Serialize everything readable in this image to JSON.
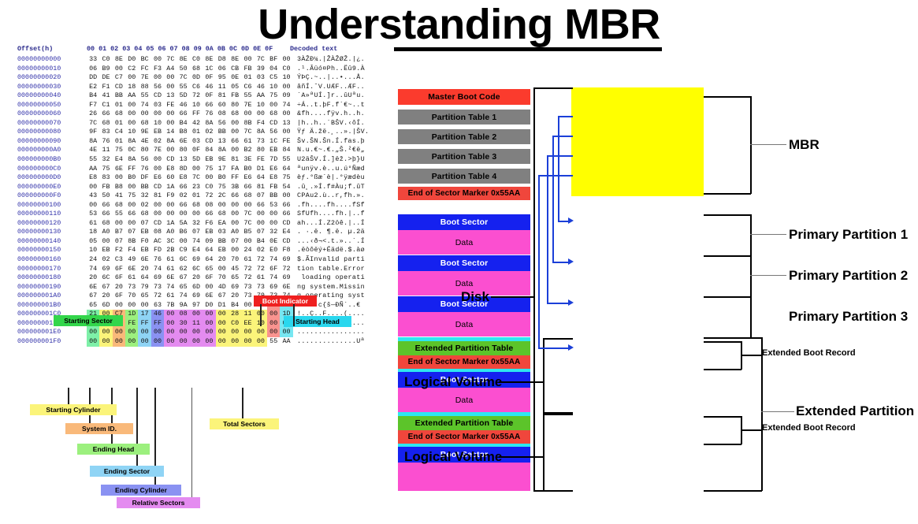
{
  "title": "Understanding MBR",
  "hex_editor": {
    "header": {
      "offset_label": "Offset(h)",
      "byte_columns": "00 01 02 03 04 05 06 07 08 09 0A 0B 0C 0D 0E 0F",
      "ascii_label": "Decoded text"
    },
    "rows": [
      {
        "offset": "00000000000",
        "bytes": "33 C0 8E D0 BC 00 7C 8E C0 8E D8 8E 00 7C BF 00",
        "ascii": "3ÀŽÐ¼.|ŽÀŽØŽ.|¿."
      },
      {
        "offset": "00000000010",
        "bytes": "06 B9 00 C2 FC F3 A4 50 68 1C 06 CB FB 39 04 C0",
        "ascii": ".¹.Âüó¤Ph..Ëû9.À"
      },
      {
        "offset": "00000000020",
        "bytes": "DD DE C7 00 7E 00 00 7C 0D 0F 95 0E 01 03 C5 10",
        "ascii": "ÝÞÇ.~..|..•...Å."
      },
      {
        "offset": "00000000030",
        "bytes": "E2 F1 CD 18 88 56 00 55 C6 46 11 05 C6 46 10 00",
        "ascii": "âñÍ.ˆV.UÆF..ÆF.."
      },
      {
        "offset": "00000000040",
        "bytes": "B4 41 BB AA 55 CD 13 5D 72 0F 81 FB 55 AA 75 09",
        "ascii": "´A»ªUÍ.]r..ûUªu."
      },
      {
        "offset": "00000000050",
        "bytes": "F7 C1 01 00 74 03 FE 46 10 66 60 80 7E 10 00 74",
        "ascii": "÷Á..t.þF.f`€~..t"
      },
      {
        "offset": "00000000060",
        "bytes": "26 66 68 00 00 00 00 66 FF 76 08 68 00 00 68 00",
        "ascii": "&fh....fÿv.h..h."
      },
      {
        "offset": "00000000070",
        "bytes": "7C 68 01 00 68 10 00 B4 42 8A 56 00 8B F4 CD 13",
        "ascii": "|h..h..´BŠV.‹ôÍ."
      },
      {
        "offset": "00000000080",
        "bytes": "9F 83 C4 10 9E EB 14 B8 01 02 BB 00 7C 8A 56 00",
        "ascii": "Ÿƒ Ä.žë.¸..».|ŠV."
      },
      {
        "offset": "00000000090",
        "bytes": "8A 76 01 8A 4E 02 8A 6E 03 CD 13 66 61 73 1C FE",
        "ascii": "Šv.ŠN.Šn.Í.fas.þ"
      },
      {
        "offset": "000000000A0",
        "bytes": "4E 11 75 0C 80 7E 00 80 0F 84 8A 00 B2 80 EB 84",
        "ascii": "N.u.€~.€.„Š.²€ë„"
      },
      {
        "offset": "000000000B0",
        "bytes": "55 32 E4 8A 56 00 CD 13 5D EB 9E 81 3E FE 7D 55",
        "ascii": "U2äŠV.Í.]ëž.>þ}U"
      },
      {
        "offset": "000000000C0",
        "bytes": "AA 75 6E FF 76 00 E8 8D 00 75 17 FA B0 D1 E6 64",
        "ascii": "ªunÿv.è..u.ú°Ñæd"
      },
      {
        "offset": "000000000D0",
        "bytes": "E8 83 00 B0 DF E6 60 E8 7C 00 B0 FF E6 64 E8 75",
        "ascii": "èƒ.°ßæ`è|.°ÿædèu"
      },
      {
        "offset": "000000000E0",
        "bytes": "00 FB B8 00 BB CD 1A 66 23 C0 75 3B 66 81 FB 54",
        "ascii": ".û¸.»Í.f#Àu;f.ûT"
      },
      {
        "offset": "000000000F0",
        "bytes": "43 50 41 75 32 81 F9 02 01 72 2C 66 68 07 BB 00",
        "ascii": "CPAu2.ù..r,fh.»."
      },
      {
        "offset": "00000000100",
        "bytes": "00 66 68 00 02 00 00 66 68 08 00 00 00 66 53 66",
        "ascii": ".fh....fh....fSf"
      },
      {
        "offset": "00000000110",
        "bytes": "53 66 55 66 68 00 00 00 00 66 68 00 7C 00 00 66",
        "ascii": "SfUfh....fh.|..f"
      },
      {
        "offset": "00000000120",
        "bytes": "61 68 00 00 07 CD 1A 5A 32 F6 EA 00 7C 00 00 CD",
        "ascii": "ah...Í.Z2öê.|..Í"
      },
      {
        "offset": "00000000130",
        "bytes": "18 A0 B7 07 EB 08 A0 B6 07 EB 03 A0 B5 07 32 E4",
        "ascii": ". ·.ë. ¶.ë. µ.2ä"
      },
      {
        "offset": "00000000140",
        "bytes": "05 00 07 8B F0 AC 3C 00 74 09 BB 07 00 B4 0E CD",
        "ascii": "...‹ð¬<.t.»..´.Í"
      },
      {
        "offset": "00000000150",
        "bytes": "10 EB F2 F4 EB FD 2B C9 E4 64 EB 00 24 02 E0 F8",
        "ascii": ".ëòôëý+Éädë.$.àø"
      },
      {
        "offset": "00000000160",
        "bytes": "24 02 C3 49 6E 76 61 6C 69 64 20 70 61 72 74 69",
        "ascii": "$.ÃInvalid parti"
      },
      {
        "offset": "00000000170",
        "bytes": "74 69 6F 6E 20 74 61 62 6C 65 00 45 72 72 6F 72",
        "ascii": "tion table.Error"
      },
      {
        "offset": "00000000180",
        "bytes": "20 6C 6F 61 64 69 6E 67 20 6F 70 65 72 61 74 69",
        "ascii": " loading operati"
      },
      {
        "offset": "00000000190",
        "bytes": "6E 67 20 73 79 73 74 65 6D 00 4D 69 73 73 69 6E",
        "ascii": "ng system.Missin"
      },
      {
        "offset": "000000001A0",
        "bytes": "67 20 6F 70 65 72 61 74 69 6E 67 20 73 79 73 74",
        "ascii": "g operating syst"
      },
      {
        "offset": "000000001B0",
        "bytes": "65 6D 00 00 00 63 7B 9A 97 D0 D1 B4 00 00 80 20",
        "ascii": "em...c{š—ÐÑ´..€ "
      },
      {
        "offset": "000000001C0",
        "bytes": "21 00 C7 1D 17 46 00 08 00 00 00 28 11 00 00 1D",
        "ascii": "!..Ç..F....(...."
      },
      {
        "offset": "000000001D0",
        "bytes": "18 46 C7 FE FF FF 00 30 11 00 00 C0 EE 10 00 00",
        "ascii": ".FÇþÿÿ.0...Àî..."
      },
      {
        "offset": "000000001E0",
        "bytes": "00 00 00 00 00 00 00 00 00 00 00 00 00 00 00 00",
        "ascii": "................"
      },
      {
        "offset": "000000001F0",
        "bytes": "00 00 00 00 00 00 00 00 00 00 00 00 00 00 55 AA",
        "ascii": "..............Uª"
      }
    ],
    "callouts": [
      {
        "name": "boot-indicator",
        "label": "Boot Indicator",
        "color": "#ef2020",
        "text_color": "#ffffff"
      },
      {
        "name": "starting-sector",
        "label": "Starting Sector",
        "color": "#33d64b",
        "text_color": "#000000"
      },
      {
        "name": "starting-head",
        "label": "Starting Head",
        "color": "#2ad7ee",
        "text_color": "#000000"
      },
      {
        "name": "starting-cylinder",
        "label": "Starting Cylinder",
        "color": "#fbf47a",
        "text_color": "#000000"
      },
      {
        "name": "system-id",
        "label": "System ID.",
        "color": "#f9b97a",
        "text_color": "#000000"
      },
      {
        "name": "ending-head",
        "label": "Ending Head",
        "color": "#9cf07e",
        "text_color": "#000000"
      },
      {
        "name": "ending-sector",
        "label": "Ending Sector",
        "color": "#8fd4f5",
        "text_color": "#000000"
      },
      {
        "name": "ending-cylinder",
        "label": "Ending Cylinder",
        "color": "#8a92f2",
        "text_color": "#000000"
      },
      {
        "name": "relative-sectors",
        "label": "Relative Sectors",
        "color": "#e48bf0",
        "text_color": "#000000"
      },
      {
        "name": "total-sectors",
        "label": "Total Sectors",
        "color": "#fbf47a",
        "text_color": "#000000"
      }
    ]
  },
  "diagram": {
    "blocks": {
      "master_boot_code": "Master Boot Code",
      "partition_table_1": "Partition Table 1",
      "partition_table_2": "Partition Table 2",
      "partition_table_3": "Partition Table 3",
      "partition_table_4": "Partition Table 4",
      "end_of_sector_marker": "End of Sector Marker 0x55AA",
      "boot_sector": "Boot Sector",
      "data": "Data",
      "extended_partition_table": "Extended Partition Table"
    },
    "left_labels": {
      "disk": "Disk",
      "logical_volume_1": "Logical Volume",
      "logical_volume_2": "Logical Volume"
    },
    "right_labels": {
      "mbr": "MBR",
      "primary_partition_1": "Primary Partition 1",
      "primary_partition_2": "Primary Partition 2",
      "primary_partition_3": "Primary Partition 3",
      "extended_boot_record_1": "Extended Boot Record",
      "extended_partition": "Extended Partition",
      "extended_boot_record_2": "Extended Boot Record"
    },
    "colors": {
      "mbr_background": "#ffff00",
      "boot_code": "#fb3b2d",
      "partition_table": "#808080",
      "boot_sector": "#1521ef",
      "data": "#fb4fd0",
      "extended_table": "#5cc42a",
      "marker": "#f0463c",
      "divider": "#2ee7f0",
      "arrow": "#1b3fd8"
    }
  }
}
